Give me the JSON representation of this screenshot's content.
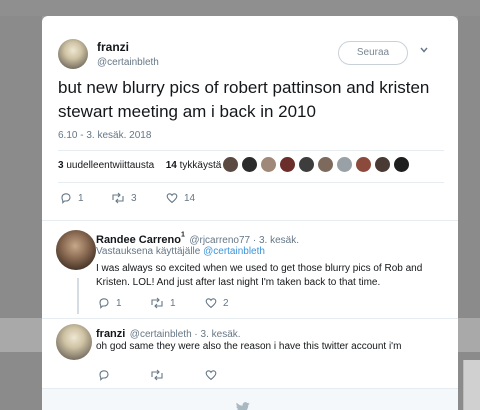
{
  "tweet": {
    "author_name": "franzi",
    "author_handle": "@certainbleth",
    "follow_label": "Seuraa",
    "text": "but new blurry pics of robert pattinson and kristen stewart meeting am i back in 2010",
    "date": "6.10 - 3. kesäk. 2018",
    "retweets_count": "3",
    "retweets_label": "uudelleentwiittausta",
    "likes_count": "14",
    "likes_label": "tykkäystä",
    "reply_count": "1",
    "retweet_count": "3",
    "like_count": "14"
  },
  "replies": [
    {
      "author_name": "Randee Carreno",
      "badge": "1",
      "meta": "@rjcarreno77 · 3. kesäk.",
      "replying_to_prefix": "Vastauksena käyttäjälle",
      "replying_to_handle": "@certainbleth",
      "text": "I was always so excited when we used to get those blurry pics of Rob and Kristen. LOL! And just after last night I'm taken back to that time.",
      "reply_count": "1",
      "retweet_count": "1",
      "like_count": "2"
    },
    {
      "author_name": "franzi",
      "meta": "@certainbleth · 3. kesäk.",
      "text": "oh god same they were also the reason i have this twitter account i'm"
    }
  ],
  "icons": {
    "reply": "reply-icon",
    "retweet": "retweet-icon",
    "like": "heart-icon",
    "more": "chevron-down-icon",
    "logo": "twitter-bird-icon"
  },
  "colors": {
    "text": "#14171a",
    "muted": "#657786",
    "link": "#3b94d9",
    "divider": "#e6ecf0"
  }
}
